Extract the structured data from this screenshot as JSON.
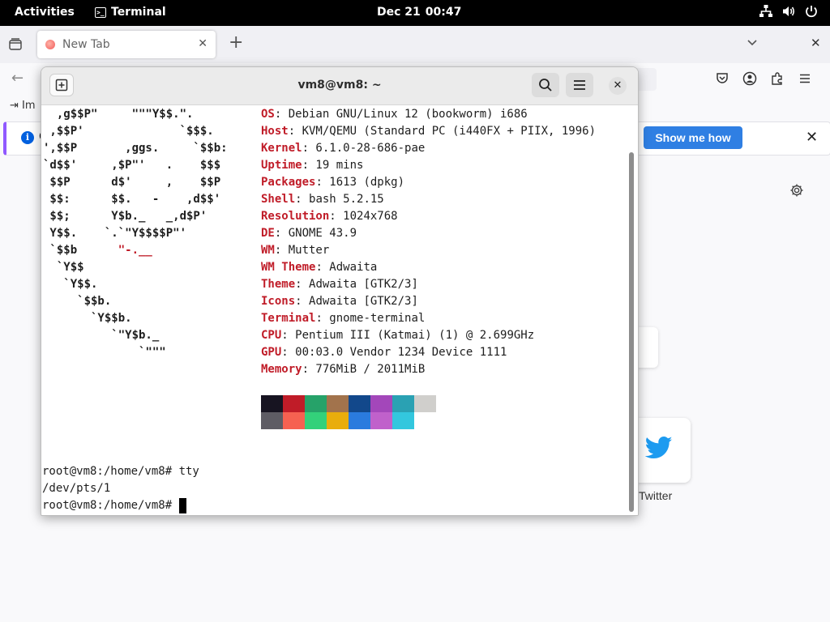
{
  "topbar": {
    "activities": "Activities",
    "app_name": "Terminal",
    "date": "Dec 21",
    "time": "00:47",
    "status_icons": [
      "network-icon",
      "volume-icon",
      "power-icon"
    ]
  },
  "browser": {
    "tab_title": "New Tab",
    "new_tab_symbol": "+",
    "tab_close_symbol": "✕",
    "window_close_symbol": "✕",
    "back_symbol": "←",
    "bookmark_import": "Im",
    "notification": {
      "text": "C",
      "button": "Show me how",
      "close_symbol": "✕"
    },
    "shortcut_twitter": "Twitter",
    "accent_color": "#2f7fe3"
  },
  "terminal": {
    "title": "vm8@vm8: ~",
    "close_symbol": "✕",
    "logo": [
      [
        "  ,g$$P\"     \"\"\"Y$$.\".",
        ""
      ],
      [
        " ,$$P'              `$$$.",
        ""
      ],
      [
        "',$$P       ,ggs.     `$$b:",
        ""
      ],
      [
        "`d$$'     ,$P\"'   .    $$$",
        ""
      ],
      [
        " $$P      d$'     ,    $$P",
        ""
      ],
      [
        " $$:      $$.   -    ,d$$'",
        ""
      ],
      [
        " $$;      Y$b._   _,d$P'",
        ""
      ],
      [
        " Y$$.    `.`\"Y$$$$P\"'",
        ""
      ],
      [
        " `$$b      ",
        "\"-.__"
      ],
      [
        "  `Y$$",
        ""
      ],
      [
        "   `Y$$.",
        ""
      ],
      [
        "     `$$b.",
        ""
      ],
      [
        "       `Y$$b.",
        ""
      ],
      [
        "          `\"Y$b._",
        ""
      ],
      [
        "              `\"\"\"",
        ""
      ]
    ],
    "info": [
      {
        "key": "OS",
        "value": ": Debian GNU/Linux 12 (bookworm) i686"
      },
      {
        "key": "Host",
        "value": ": KVM/QEMU (Standard PC (i440FX + PIIX, 1996)"
      },
      {
        "key": "Kernel",
        "value": ": 6.1.0-28-686-pae"
      },
      {
        "key": "Uptime",
        "value": ": 19 mins"
      },
      {
        "key": "Packages",
        "value": ": 1613 (dpkg)"
      },
      {
        "key": "Shell",
        "value": ": bash 5.2.15"
      },
      {
        "key": "Resolution",
        "value": ": 1024x768"
      },
      {
        "key": "DE",
        "value": ": GNOME 43.9"
      },
      {
        "key": "WM",
        "value": ": Mutter"
      },
      {
        "key": "WM Theme",
        "value": ": Adwaita"
      },
      {
        "key": "Theme",
        "value": ": Adwaita [GTK2/3]"
      },
      {
        "key": "Icons",
        "value": ": Adwaita [GTK2/3]"
      },
      {
        "key": "Terminal",
        "value": ": gnome-terminal"
      },
      {
        "key": "CPU",
        "value": ": Pentium III (Katmai) (1) @ 2.699GHz"
      },
      {
        "key": "GPU",
        "value": ": 00:03.0 Vendor 1234 Device 1111"
      },
      {
        "key": "Memory",
        "value": ": 776MiB / 2011MiB"
      }
    ],
    "palette_row1": [
      "#171421",
      "#c01c28",
      "#26a269",
      "#a2734c",
      "#12488b",
      "#a347ba",
      "#2aa1b3",
      "#d0cfcc"
    ],
    "palette_row2": [
      "#5e5c64",
      "#f66151",
      "#33d17a",
      "#e9ad0c",
      "#2a7bde",
      "#c061cb",
      "#33c7de",
      "#ffffff"
    ],
    "prompt_lines": [
      "root@vm8:/home/vm8# tty",
      "/dev/pts/1",
      "root@vm8:/home/vm8# "
    ],
    "key_color": "#c01c28"
  }
}
